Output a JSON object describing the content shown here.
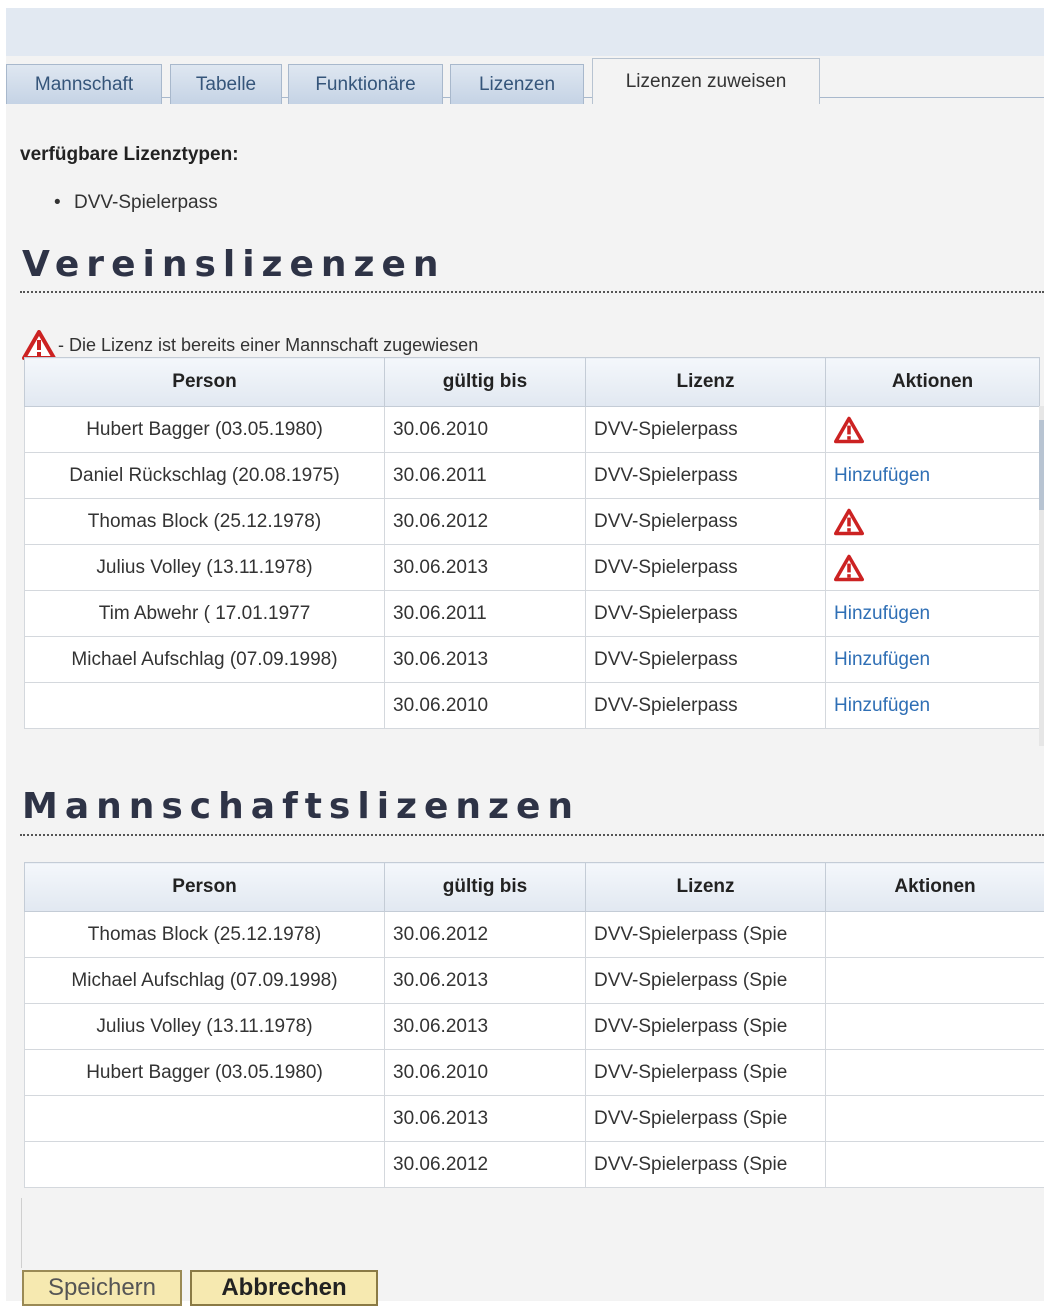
{
  "tabs": [
    {
      "label": "Mannschaft",
      "active": false
    },
    {
      "label": "Tabelle",
      "active": false
    },
    {
      "label": "Funktionäre",
      "active": false
    },
    {
      "label": "Lizenzen",
      "active": false
    },
    {
      "label": "Lizenzen zuweisen",
      "active": true
    }
  ],
  "available": {
    "label": "verfügbare Lizenztypen:",
    "items": [
      "DVV-Spielerpass"
    ]
  },
  "club_licenses": {
    "title": "Vereinslizenzen",
    "legend": "- Die Lizenz ist bereits einer Mannschaft zugewiesen",
    "columns": [
      "Person",
      "gültig bis",
      "Lizenz",
      "Aktionen"
    ],
    "rows": [
      {
        "person": "Hubert Bagger (03.05.1980)",
        "valid": "30.06.2010",
        "license": "DVV-Spielerpass",
        "action": "warning-icon"
      },
      {
        "person": "Daniel Rückschlag (20.08.1975)",
        "valid": "30.06.2011",
        "license": "DVV-Spielerpass",
        "action": "Hinzufügen"
      },
      {
        "person": "Thomas Block (25.12.1978)",
        "valid": "30.06.2012",
        "license": "DVV-Spielerpass",
        "action": "warning-icon"
      },
      {
        "person": "Julius Volley (13.11.1978)",
        "valid": "30.06.2013",
        "license": "DVV-Spielerpass",
        "action": "warning-icon"
      },
      {
        "person": "Tim Abwehr ( 17.01.1977",
        "valid": "30.06.2011",
        "license": "DVV-Spielerpass",
        "action": "Hinzufügen"
      },
      {
        "person": "Michael Aufschlag (07.09.1998)",
        "valid": "30.06.2013",
        "license": "DVV-Spielerpass",
        "action": "Hinzufügen"
      },
      {
        "person": "",
        "valid": "30.06.2010",
        "license": "DVV-Spielerpass",
        "action": "Hinzufügen"
      }
    ]
  },
  "team_licenses": {
    "title": "Mannschaftslizenzen",
    "columns": [
      "Person",
      "gültig bis",
      "Lizenz",
      "Aktionen"
    ],
    "rows": [
      {
        "person": "Thomas Block (25.12.1978)",
        "valid": "30.06.2012",
        "license": "DVV-Spielerpass (Spie",
        "action": ""
      },
      {
        "person": "Michael Aufschlag (07.09.1998)",
        "valid": "30.06.2013",
        "license": "DVV-Spielerpass (Spie",
        "action": ""
      },
      {
        "person": "Julius Volley (13.11.1978)",
        "valid": "30.06.2013",
        "license": "DVV-Spielerpass (Spie",
        "action": ""
      },
      {
        "person": "Hubert Bagger (03.05.1980)",
        "valid": "30.06.2010",
        "license": "DVV-Spielerpass (Spie",
        "action": ""
      },
      {
        "person": "",
        "valid": "30.06.2013",
        "license": "DVV-Spielerpass (Spie",
        "action": ""
      },
      {
        "person": "",
        "valid": "30.06.2012",
        "license": "DVV-Spielerpass (Spie",
        "action": ""
      }
    ]
  },
  "buttons": {
    "save": "Speichern",
    "cancel": "Abbrechen"
  },
  "colors": {
    "warning": "#cc2222",
    "link": "#2f6fb5",
    "button_bg": "#f6e9b0"
  }
}
